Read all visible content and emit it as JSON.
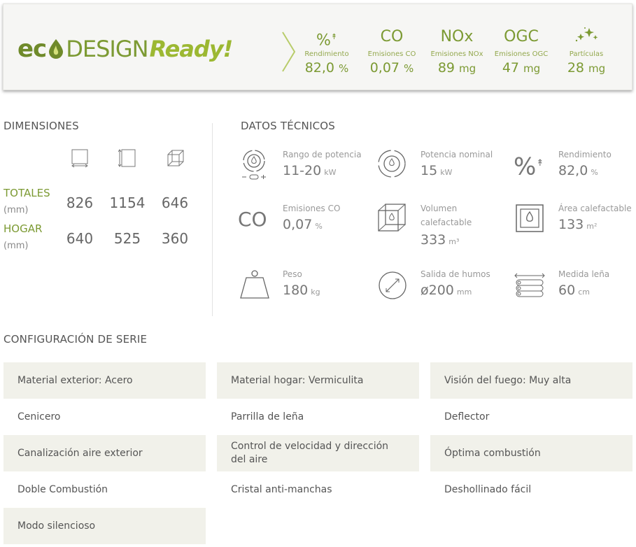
{
  "banner": {
    "logo": {
      "eco": "ec",
      "design": "DESIGN",
      "ready": "Ready!"
    },
    "metrics": [
      {
        "symbol": "%",
        "label": "Rendimiento",
        "value": "82,0",
        "unit": "%"
      },
      {
        "symbol": "CO",
        "label": "Emisiones CO",
        "value": "0,07",
        "unit": "%"
      },
      {
        "symbol": "NOx",
        "label": "Emisiones NOx",
        "value": "89",
        "unit": "mg"
      },
      {
        "symbol": "OGC",
        "label": "Emisiones OGC",
        "value": "47",
        "unit": "mg"
      },
      {
        "symbol": "",
        "label": "Partículas",
        "value": "28",
        "unit": "mg"
      }
    ]
  },
  "dimensiones": {
    "title": "DIMENSIONES",
    "rows": [
      {
        "label": "TOTALES",
        "unit": "(mm)",
        "values": [
          "826",
          "1154",
          "646"
        ]
      },
      {
        "label": "HOGAR",
        "unit": "(mm)",
        "values": [
          "640",
          "525",
          "360"
        ]
      }
    ]
  },
  "datos": {
    "title": "DATOS TÉCNICOS",
    "items": [
      {
        "label": "Rango de potencia",
        "value": "11-20",
        "unit": "kW"
      },
      {
        "label": "Potencia nominal",
        "value": "15",
        "unit": "kW"
      },
      {
        "label": "Rendimiento",
        "value": "82,0",
        "unit": "%"
      },
      {
        "label": "Emisiones CO",
        "value": "0,07",
        "unit": "%"
      },
      {
        "label": "Volumen calefactable",
        "value": "333",
        "unit": "m³"
      },
      {
        "label": "Área calefactable",
        "value": "133",
        "unit": "m²"
      },
      {
        "label": "Peso",
        "value": "180",
        "unit": "kg"
      },
      {
        "label": "Salida de humos",
        "value": "ø200",
        "unit": "mm"
      },
      {
        "label": "Medida leña",
        "value": "60",
        "unit": "cm"
      }
    ],
    "co_symbol": "CO",
    "pct_symbol": "%"
  },
  "config": {
    "title": "CONFIGURACIÓN DE SERIE",
    "items": [
      "Material exterior: Acero",
      "Material hogar: Vermiculita",
      "Visión del fuego: Muy alta",
      "Cenicero",
      "Parrilla de leña",
      "Deflector",
      "Canalización aire exterior",
      "Control de velocidad y dirección del aire",
      "Óptima combustión",
      "Doble Combustión",
      "Cristal anti-manchas",
      "Deshollinado fácil",
      "Modo silencioso"
    ]
  },
  "colors": {
    "accent": "#7c9a33",
    "light_accent": "#9cb832",
    "cell_shade": "#f1f1ea"
  }
}
